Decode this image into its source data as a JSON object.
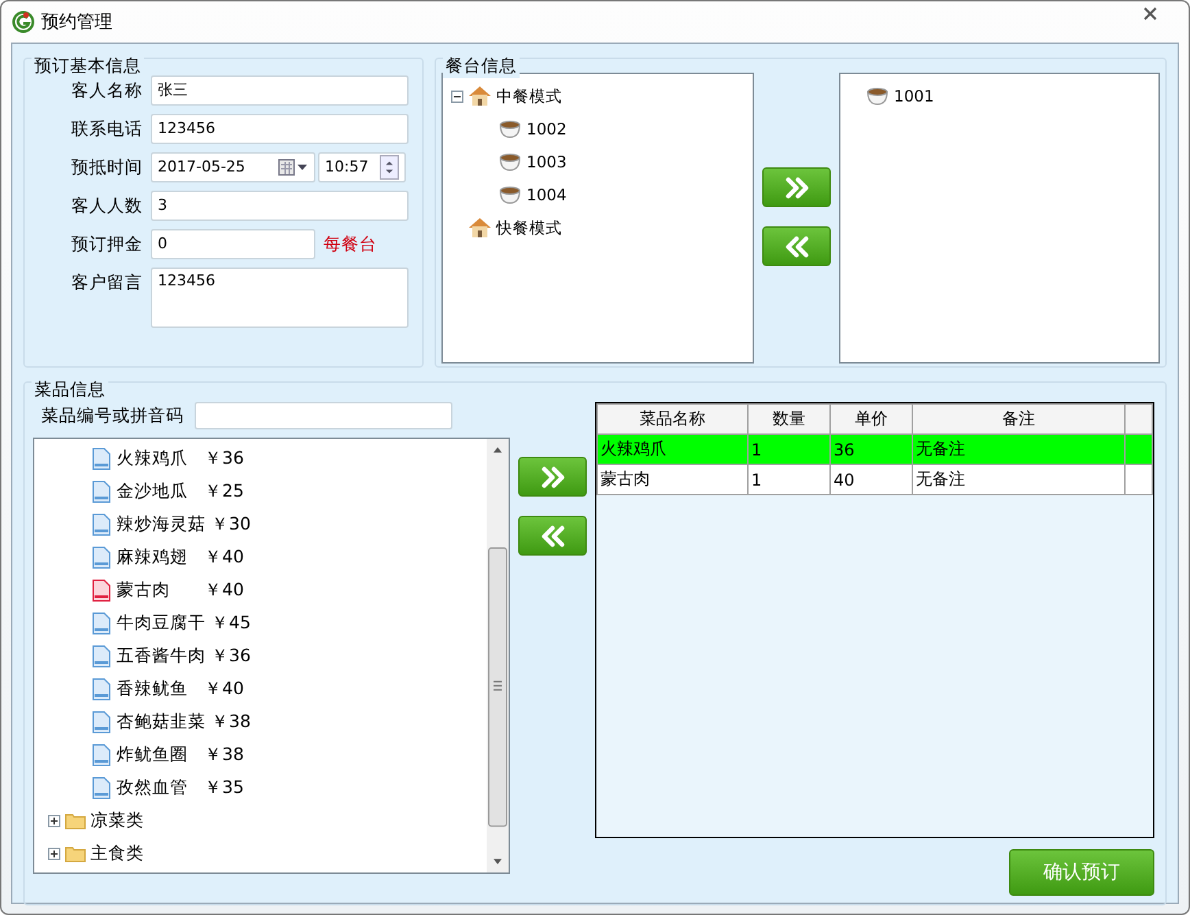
{
  "window": {
    "title": "预约管理"
  },
  "basic_info": {
    "title": "预订基本信息",
    "fields": [
      {
        "kind": "text",
        "label": "客人名称",
        "value": "张三"
      },
      {
        "kind": "text",
        "label": "联系电话",
        "value": "123456"
      },
      {
        "kind": "datetime",
        "label": "预抵时间",
        "value": "2017-05-25",
        "time": "10:57"
      },
      {
        "kind": "text",
        "label": "客人人数",
        "value": "3"
      },
      {
        "kind": "note",
        "label": "预订押金",
        "value": "0",
        "note": "每餐台"
      },
      {
        "kind": "multiline",
        "label": "客户留言",
        "value": "123456"
      }
    ]
  },
  "table_info": {
    "title": "餐台信息",
    "available": [
      {
        "kind": "area",
        "label": "中餐模式",
        "expanded": true,
        "children": [
          {
            "kind": "table",
            "label": "1002"
          },
          {
            "kind": "table",
            "label": "1003"
          },
          {
            "kind": "table",
            "label": "1004"
          }
        ]
      },
      {
        "kind": "area",
        "label": "快餐模式"
      }
    ],
    "chosen": [
      {
        "kind": "table",
        "label": "1001"
      }
    ]
  },
  "dish_info": {
    "title": "菜品信息",
    "search_label": "菜品编号或拼音码",
    "tree": [
      {
        "kind": "dish",
        "name": "火辣鸡爪",
        "price": "￥36",
        "marked": false
      },
      {
        "kind": "dish",
        "name": "金沙地瓜",
        "price": "￥25",
        "marked": false
      },
      {
        "kind": "dish",
        "name": "辣炒海灵菇",
        "price": "￥30",
        "marked": false
      },
      {
        "kind": "dish",
        "name": "麻辣鸡翅",
        "price": "￥40",
        "marked": false
      },
      {
        "kind": "dish",
        "name": "蒙古肉",
        "price": "￥40",
        "marked": true
      },
      {
        "kind": "dish",
        "name": "牛肉豆腐干",
        "price": "￥45",
        "marked": false
      },
      {
        "kind": "dish",
        "name": "五香酱牛肉",
        "price": "￥36",
        "marked": false
      },
      {
        "kind": "dish",
        "name": "香辣鱿鱼",
        "price": "￥40",
        "marked": false
      },
      {
        "kind": "dish",
        "name": "杏鲍菇韭菜",
        "price": "￥38",
        "marked": false
      },
      {
        "kind": "dish",
        "name": "炸鱿鱼圈",
        "price": "￥38",
        "marked": false
      },
      {
        "kind": "dish",
        "name": "孜然血管",
        "price": "￥35",
        "marked": false
      },
      {
        "kind": "category",
        "name": "凉菜类",
        "expanded": false
      },
      {
        "kind": "category",
        "name": "主食类",
        "expanded": false
      }
    ],
    "order": {
      "columns": [
        "菜品名称",
        "数量",
        "单价",
        "备注"
      ],
      "rows": [
        {
          "cells": [
            "火辣鸡爪",
            "1",
            "36",
            "无备注"
          ],
          "selected": true
        },
        {
          "cells": [
            "蒙古肉",
            "1",
            "40",
            "无备注"
          ],
          "selected": false
        }
      ]
    },
    "confirm_button": "确认预订"
  }
}
